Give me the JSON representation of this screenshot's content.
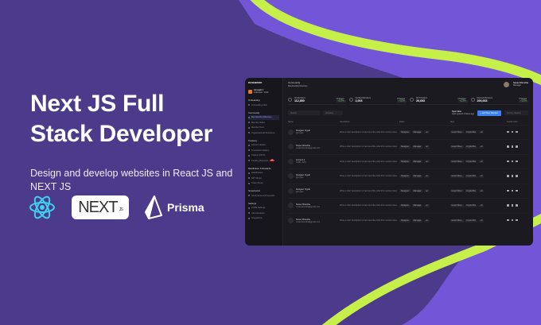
{
  "hero": {
    "title_line1": "Next JS Full",
    "title_line2": "Stack Developer",
    "subtitle": "Design and develop websites in React JS and NEXT JS"
  },
  "logos": {
    "react": "React",
    "next": "NEXT",
    "next_suffix": ".JS",
    "prisma": "Prisma"
  },
  "colors": {
    "bg": "#4c3a8b",
    "blob": "#7356d8",
    "accent_lime": "#c6ef4a",
    "dash_bg": "#1b1a21",
    "primary": "#3b82f6"
  },
  "dashboard": {
    "brand": "DASHBOOK",
    "account": {
      "name": "Account 1",
      "sub": "Individual · 2024"
    },
    "breadcrumb_title": "Community",
    "breadcrumb": "Membership Directory",
    "user": {
      "name": "Susan Shrestha",
      "role": "Manager"
    },
    "sidebar": [
      {
        "section": "Onboarding",
        "items": [
          "Onboarding Flow"
        ]
      },
      {
        "section": "Community",
        "items": [
          "Membership Directory",
          "Member Roles",
          "Member Tiers",
          "Organizational Structures"
        ]
      },
      {
        "section": "Treasury",
        "items": [
          "Account details",
          "Transaction History",
          "Tokens & NFTs",
          "Pending Requests"
        ],
        "badge": "12"
      },
      {
        "section": "Distribution & Rewards",
        "items": [
          "Distributions",
          "NFT Drops",
          "Token Drops"
        ]
      },
      {
        "section": "Governance",
        "items": [
          "Governance & Proposals"
        ]
      },
      {
        "section": "Settings",
        "items": [
          "Profile Settings",
          "Administrators",
          "Integrations"
        ]
      }
    ],
    "stats": [
      {
        "label": "All Members",
        "value": "112,850",
        "change_label": "Changes",
        "change": "+12.5%"
      },
      {
        "label": "Verified Members",
        "value": "2,003",
        "change_label": "Changes",
        "change": "+12.5%"
      },
      {
        "label": "NFT Holders",
        "value": "20,693",
        "change_label": "Changes",
        "change": "+12.5%"
      },
      {
        "label": "Discord Members",
        "value": "200,003",
        "change_label": "Changes",
        "change": "+12.5%"
      }
    ],
    "search_placeholder": "Search",
    "filter": "All Roles",
    "sync": {
      "title": "Sync Now",
      "sub": "Last synced: 2 hours ago"
    },
    "add_button": "+ Add New Member",
    "sort": "Sort by: Newest",
    "columns": [
      "Name",
      "Description",
      "Roles",
      "Tags",
      "Social Links"
    ],
    "rows": [
      {
        "name": "Designer Crypto",
        "sub": "@crypto"
      },
      {
        "name": "Susan Shrestha",
        "sub": "susanshrestha@gmail.com"
      },
      {
        "name": "Account 1",
        "sub": "0x4B...32f1"
      },
      {
        "name": "Designer Crypto",
        "sub": "@crypto"
      },
      {
        "name": "Designer Crypto",
        "sub": "@crypto"
      },
      {
        "name": "Susan Shrestha",
        "sub": "susanshrestha@gmail.com"
      },
      {
        "name": "Susan Shrestha",
        "sub": "susanshrestha@gmail.com"
      }
    ],
    "row_description": "Write a short description to best describe what this member does",
    "row_roles": [
      "Designer",
      "Manager",
      "+2"
    ],
    "row_tags": [
      "Good Vibes",
      "Crypto Bro",
      "+3"
    ]
  }
}
